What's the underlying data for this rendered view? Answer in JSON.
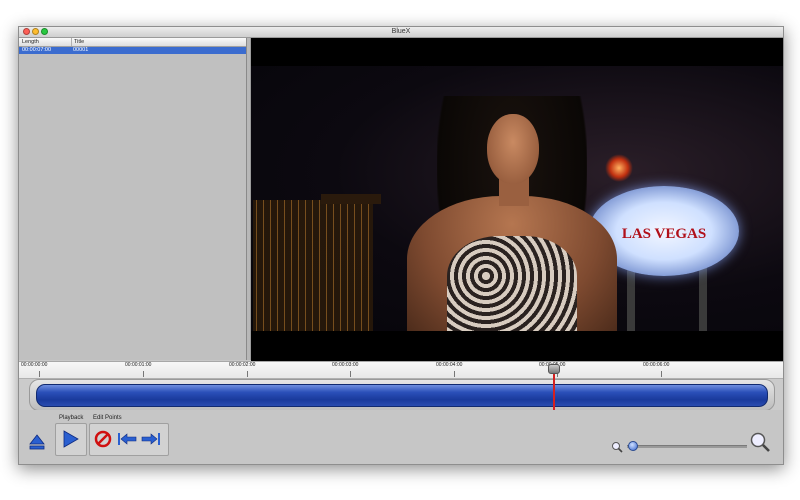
{
  "window": {
    "title": "BlueX"
  },
  "clip_list": {
    "columns": [
      "Length",
      "Title"
    ],
    "rows": [
      {
        "length": "00:00:07:00",
        "title": "00001",
        "selected": true
      }
    ]
  },
  "preview": {
    "sign_text": "LAS VEGAS"
  },
  "timeline": {
    "ticks": [
      "00:00:00:00",
      "00:00:01:00",
      "00:00:02:00",
      "00:00:03:00",
      "00:00:04:00",
      "00:00:05:00",
      "00:00:06:00"
    ],
    "playhead_time_fraction": 0.8
  },
  "toolbar": {
    "playback_label": "Playback",
    "edit_points_label": "Edit Points",
    "icons": {
      "eject": "eject-icon",
      "play": "play-icon",
      "clear": "no-entry-icon",
      "mark_in": "mark-in-icon",
      "mark_out": "mark-out-icon",
      "zoom_out": "zoom-out-icon",
      "zoom_in": "zoom-in-icon"
    },
    "colors": {
      "accent": "#2a4fb8",
      "playhead": "#d42020",
      "selection": "#3b6ccf"
    }
  }
}
